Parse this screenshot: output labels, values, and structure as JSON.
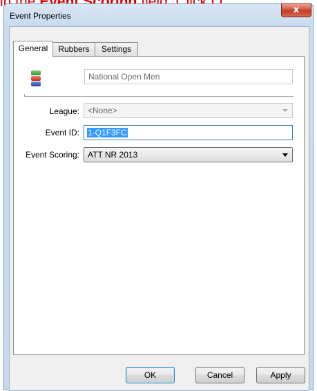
{
  "banner": {
    "prefix": "in the ",
    "bold": "Event Scoring",
    "suffix": " field. Click O"
  },
  "window": {
    "title": "Event Properties",
    "close_label": "x"
  },
  "tabs": [
    {
      "label": "General",
      "active": true
    },
    {
      "label": "Rubbers",
      "active": false
    },
    {
      "label": "Settings",
      "active": false
    }
  ],
  "general": {
    "event_name": "National Open Men",
    "league_label": "League:",
    "league_value": "<None>",
    "event_id_label": "Event ID:",
    "event_id_value": "1-Q1F3FC",
    "scoring_label": "Event Scoring:",
    "scoring_value": "ATT NR 2013",
    "icon": "event-stack-icon",
    "icon_colors": [
      "#3da03d",
      "#d93a2b",
      "#2456b8"
    ]
  },
  "buttons": {
    "ok": "OK",
    "cancel": "Cancel",
    "apply": "Apply"
  }
}
